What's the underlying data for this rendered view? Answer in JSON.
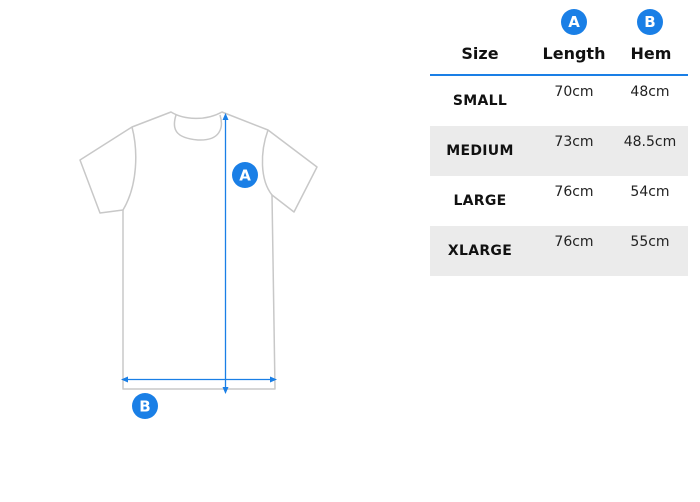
{
  "diagram": {
    "marker_length": "A",
    "marker_hem": "B"
  },
  "table": {
    "badges": {
      "length": "A",
      "hem": "B"
    },
    "headers": {
      "size": "Size",
      "length": "Length",
      "hem": "Hem"
    },
    "rows": [
      {
        "size": "SMALL",
        "length": "70cm",
        "hem": "48cm"
      },
      {
        "size": "MEDIUM",
        "length": "73cm",
        "hem": "48.5cm"
      },
      {
        "size": "LARGE",
        "length": "76cm",
        "hem": "54cm"
      },
      {
        "size": "XLARGE",
        "length": "76cm",
        "hem": "55cm"
      }
    ]
  },
  "colors": {
    "accent": "#1a7fe6",
    "outline": "#c8c8c8",
    "row_shade": "#ebebeb"
  }
}
